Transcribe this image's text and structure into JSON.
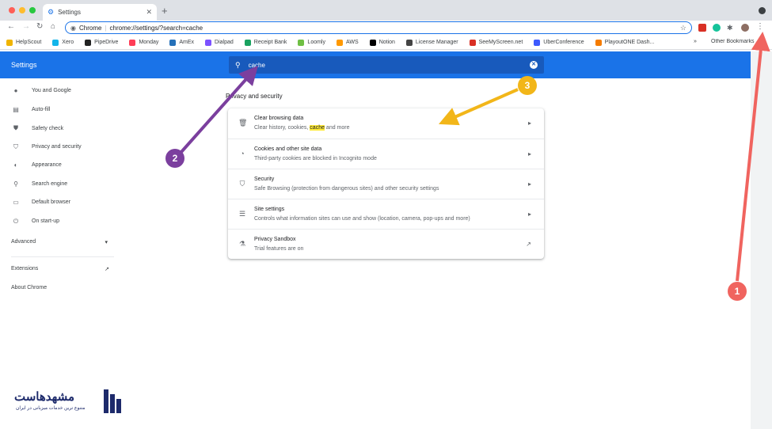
{
  "tab": {
    "title": "Settings"
  },
  "omnibox": {
    "site_label": "Chrome",
    "url": "chrome://settings/?search=cache"
  },
  "bookmarks": {
    "items": [
      {
        "label": "HelpScout",
        "color": "#f0b400"
      },
      {
        "label": "Xero",
        "color": "#13b5ea"
      },
      {
        "label": "PipeDrive",
        "color": "#222222"
      },
      {
        "label": "Monday",
        "color": "#ff3d57"
      },
      {
        "label": "AmEx",
        "color": "#2671b9"
      },
      {
        "label": "Dialpad",
        "color": "#7c52ff"
      },
      {
        "label": "Receipt Bank",
        "color": "#1aa260"
      },
      {
        "label": "Loomly",
        "color": "#6fbf44"
      },
      {
        "label": "AWS",
        "color": "#ff9900"
      },
      {
        "label": "Notion",
        "color": "#000000"
      },
      {
        "label": "License Manager",
        "color": "#444444"
      },
      {
        "label": "SeeMyScreen.net",
        "color": "#d93025"
      },
      {
        "label": "UberConference",
        "color": "#3d5afe"
      },
      {
        "label": "PlayoutONE Dash...",
        "color": "#f57c00"
      }
    ],
    "more": "»",
    "other": "Other Bookmarks"
  },
  "header": {
    "title": "Settings",
    "search_query": "cache"
  },
  "sidebar": {
    "items": [
      {
        "label": "You and Google",
        "icon": "person-icon"
      },
      {
        "label": "Auto-fill",
        "icon": "clipboard-icon"
      },
      {
        "label": "Safety check",
        "icon": "shield-check-icon"
      },
      {
        "label": "Privacy and security",
        "icon": "shield-icon"
      },
      {
        "label": "Appearance",
        "icon": "palette-icon"
      },
      {
        "label": "Search engine",
        "icon": "search-icon"
      },
      {
        "label": "Default browser",
        "icon": "browser-icon"
      },
      {
        "label": "On start-up",
        "icon": "power-icon"
      }
    ],
    "advanced": "Advanced",
    "extensions": "Extensions",
    "about": "About Chrome"
  },
  "main": {
    "section_title": "Privacy and security",
    "rows": [
      {
        "title": "Clear browsing data",
        "sub_before": "Clear history, cookies, ",
        "sub_highlight": "cache",
        "sub_after": " and more",
        "icon": "trash-icon"
      },
      {
        "title": "Cookies and other site data",
        "sub": "Third-party cookies are blocked in Incognito mode",
        "icon": "cookie-icon"
      },
      {
        "title": "Security",
        "sub": "Safe Browsing (protection from dangerous sites) and other security settings",
        "icon": "security-shield-icon"
      },
      {
        "title": "Site settings",
        "sub": "Controls what information sites can use and show (location, camera, pop-ups and more)",
        "icon": "sliders-icon"
      },
      {
        "title": "Privacy Sandbox",
        "sub": "Trial features are on",
        "icon": "flask-icon"
      }
    ]
  },
  "annotations": [
    {
      "label": "1",
      "color": "#f0645f"
    },
    {
      "label": "2",
      "color": "#7b3f9e"
    },
    {
      "label": "3",
      "color": "#f2b619"
    }
  ],
  "colors": {
    "accent": "#1a73e8",
    "header_search": "#185abc",
    "highlight": "#ffeb3b"
  },
  "watermark": {
    "logo_text": "مشهدهاست",
    "logo_sub": "متنوع ترین خدمات میزبانی در ایران"
  }
}
